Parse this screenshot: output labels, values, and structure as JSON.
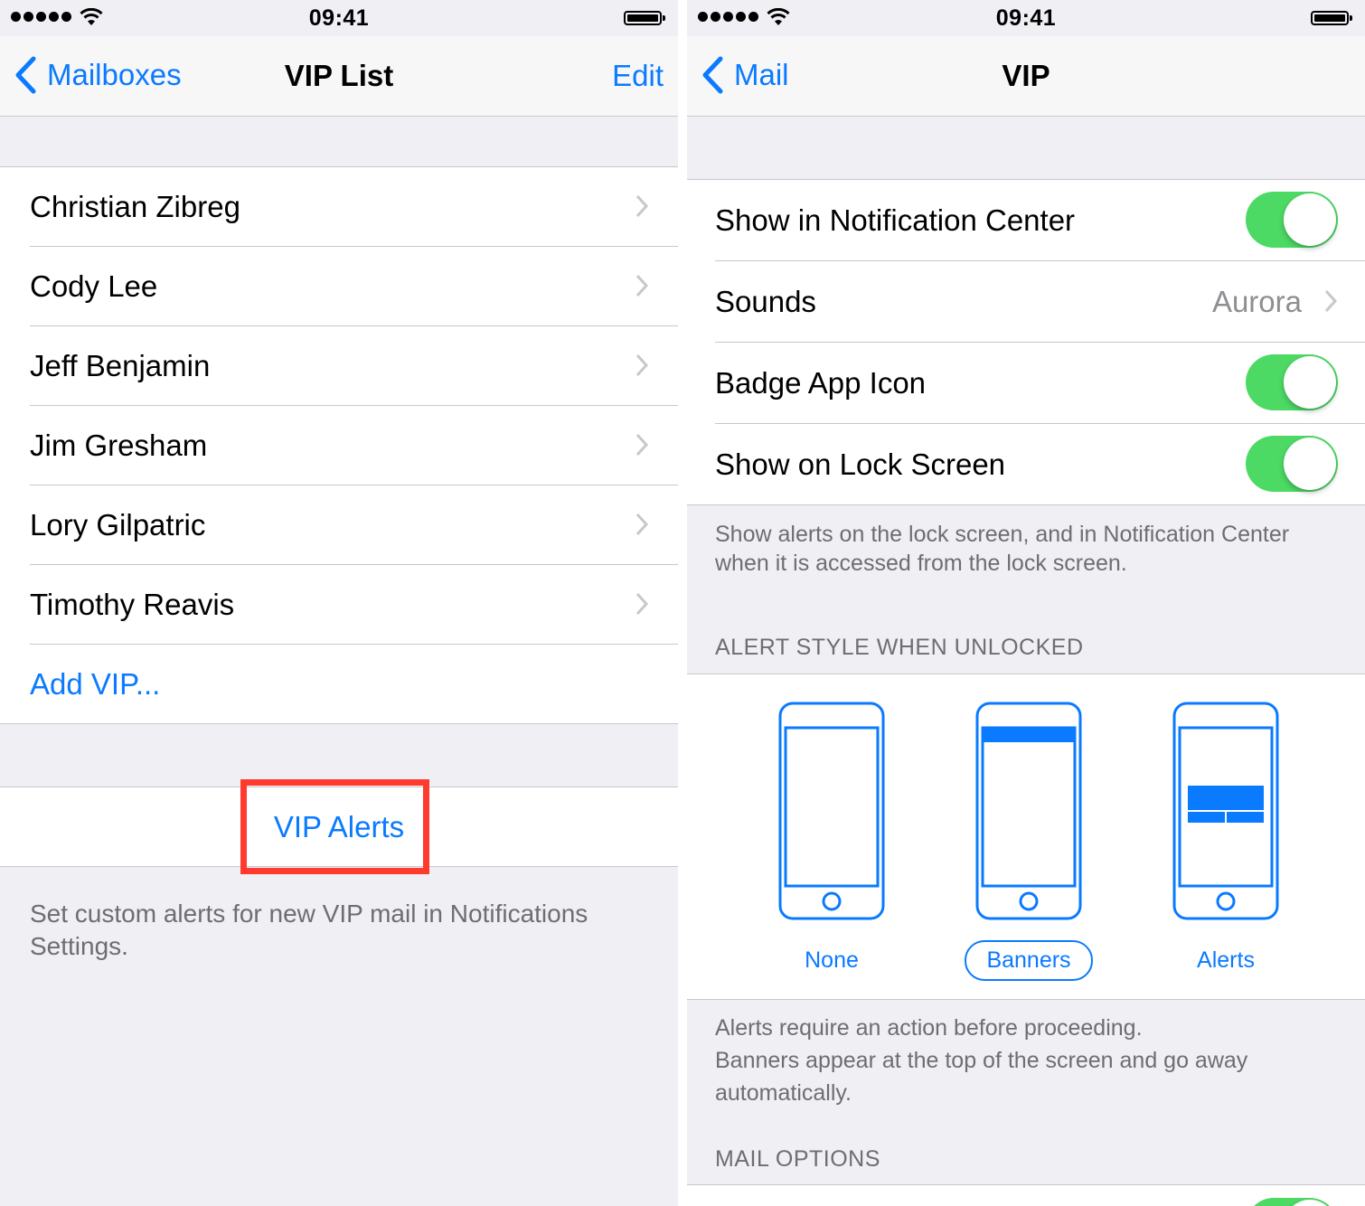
{
  "colors": {
    "accent": "#0a7aff",
    "toggle_on": "#4cd964",
    "highlight": "#ff3b30",
    "background": "#efeff4"
  },
  "left": {
    "status_bar": {
      "time": "09:41"
    },
    "nav": {
      "back_label": "Mailboxes",
      "title": "VIP List",
      "right_label": "Edit"
    },
    "vips": [
      {
        "name": "Christian Zibreg"
      },
      {
        "name": "Cody Lee"
      },
      {
        "name": "Jeff Benjamin"
      },
      {
        "name": "Jim Gresham"
      },
      {
        "name": "Lory Gilpatric"
      },
      {
        "name": "Timothy Reavis"
      }
    ],
    "add_vip_label": "Add VIP...",
    "vip_alerts_label": "VIP Alerts",
    "footer": "Set custom alerts for new VIP mail in Notifications Settings."
  },
  "right": {
    "status_bar": {
      "time": "09:41"
    },
    "nav": {
      "back_label": "Mail",
      "title": "VIP"
    },
    "settings": [
      {
        "label": "Show in Notification Center",
        "toggle_on": true
      },
      {
        "label": "Sounds",
        "value": "Aurora"
      },
      {
        "label": "Badge App Icon",
        "toggle_on": true
      },
      {
        "label": "Show on Lock Screen",
        "toggle_on": true
      }
    ],
    "lock_screen_footer": "Show alerts on the lock screen, and in Notification Center when it is accessed from the lock screen.",
    "alert_style_header": "ALERT STYLE WHEN UNLOCKED",
    "alert_styles": [
      {
        "label": "None",
        "selected": false,
        "icon": "phone-none-icon"
      },
      {
        "label": "Banners",
        "selected": true,
        "icon": "phone-banner-icon"
      },
      {
        "label": "Alerts",
        "selected": false,
        "icon": "phone-alert-icon"
      }
    ],
    "alert_footer_line1": "Alerts require an action before proceeding.",
    "alert_footer_line2": "Banners appear at the top of the screen and go away automatically.",
    "mail_options_header": "MAIL OPTIONS"
  }
}
